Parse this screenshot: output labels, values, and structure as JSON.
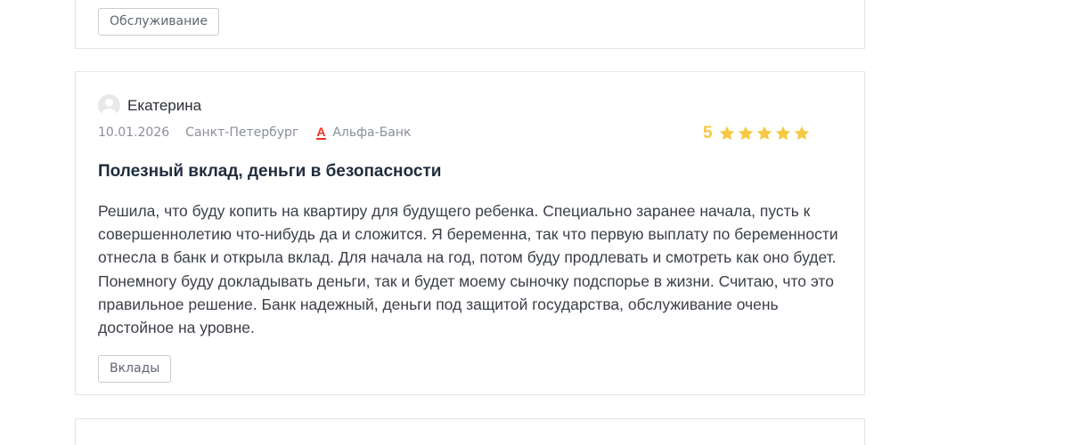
{
  "previous_review": {
    "tag": "Обслуживание"
  },
  "review": {
    "author": "Екатерина",
    "date": "10.01.2026",
    "city": "Санкт-Петербург",
    "bank": "Альфа-Банк",
    "bank_logo_letter": "А",
    "rating": "5",
    "stars_filled": 5,
    "stars_total": 5,
    "star_color": "#f6c844",
    "title": "Полезный вклад, деньги в безопасности",
    "text": "Решила, что буду копить на квартиру для будущего ребенка. Специально заранее начала, пусть к совершеннолетию что-нибудь да и сложится. Я беременна, так что первую выплату по беременности отнесла в банк и открыла вклад. Для начала на год, потом буду продлевать и смотреть как оно будет. Понемногу буду докладывать деньги, так и будет моему сыночку подспорье в жизни. Считаю, что это правильное решение. Банк надежный, деньги под защитой государства, обслуживание очень достойное на уровне.",
    "tag": "Вклады",
    "icons": {
      "avatar": "user-avatar-icon",
      "bank": "alfa-bank-logo-icon",
      "star": "star-icon"
    }
  }
}
